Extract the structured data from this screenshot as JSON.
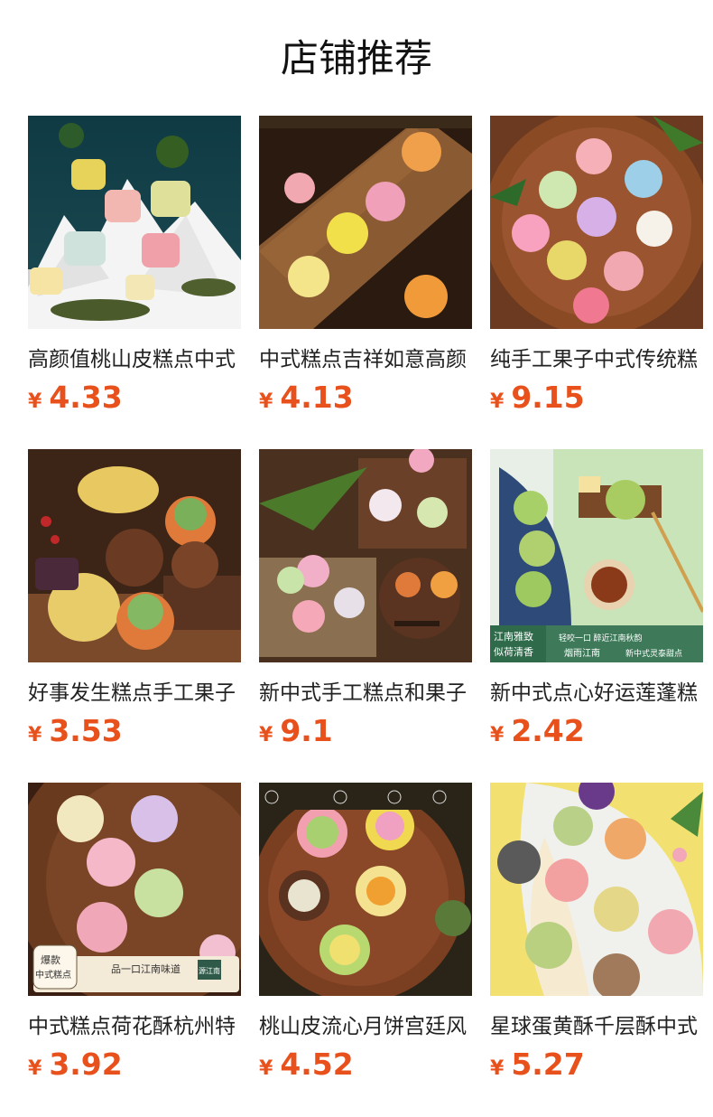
{
  "page": {
    "title": "店铺推荐"
  },
  "currency_symbol": "¥",
  "products": [
    {
      "name": "高颜值桃山皮糕点中式",
      "price": "4.33",
      "image": "peach-skin-pastry-mountain"
    },
    {
      "name": "中式糕点吉祥如意高颜",
      "price": "4.13",
      "image": "auspicious-pastry-wood-board"
    },
    {
      "name": "纯手工果子中式传统糕",
      "price": "9.15",
      "image": "flower-wagashi-round-tray"
    },
    {
      "name": "好事发生糕点手工果子",
      "price": "3.53",
      "image": "peanut-walnut-pastry"
    },
    {
      "name": "新中式手工糕点和果子",
      "price": "9.1",
      "image": "handmade-wagashi-wood-box"
    },
    {
      "name": "新中式点心好运莲蓬糕",
      "price": "2.42",
      "image": "lotus-pod-pastry-green"
    },
    {
      "name": "中式糕点荷花酥杭州特",
      "price": "3.92",
      "image": "lotus-flower-pastry-tray"
    },
    {
      "name": "桃山皮流心月饼宫廷风",
      "price": "4.52",
      "image": "mooncake-round-tray"
    },
    {
      "name": "星球蛋黄酥千层酥中式",
      "price": "5.27",
      "image": "planet-egg-yolk-pastry"
    }
  ],
  "image_texts": {
    "lotus_badge_1": "江南雅致",
    "lotus_badge_2": "似荷清香",
    "lotus_caption_1": "轻咬一口 醉近江南秋韵",
    "lotus_caption_2": "烟雨江南",
    "lotus_caption_3": "新中式灵泰甜点",
    "flower_badge_1": "爆款",
    "flower_badge_2": "中式糕点",
    "flower_caption": "品一口江南味道",
    "flower_stamp": "源江南"
  },
  "colors": {
    "price": "#e8501c",
    "title": "#111111"
  }
}
